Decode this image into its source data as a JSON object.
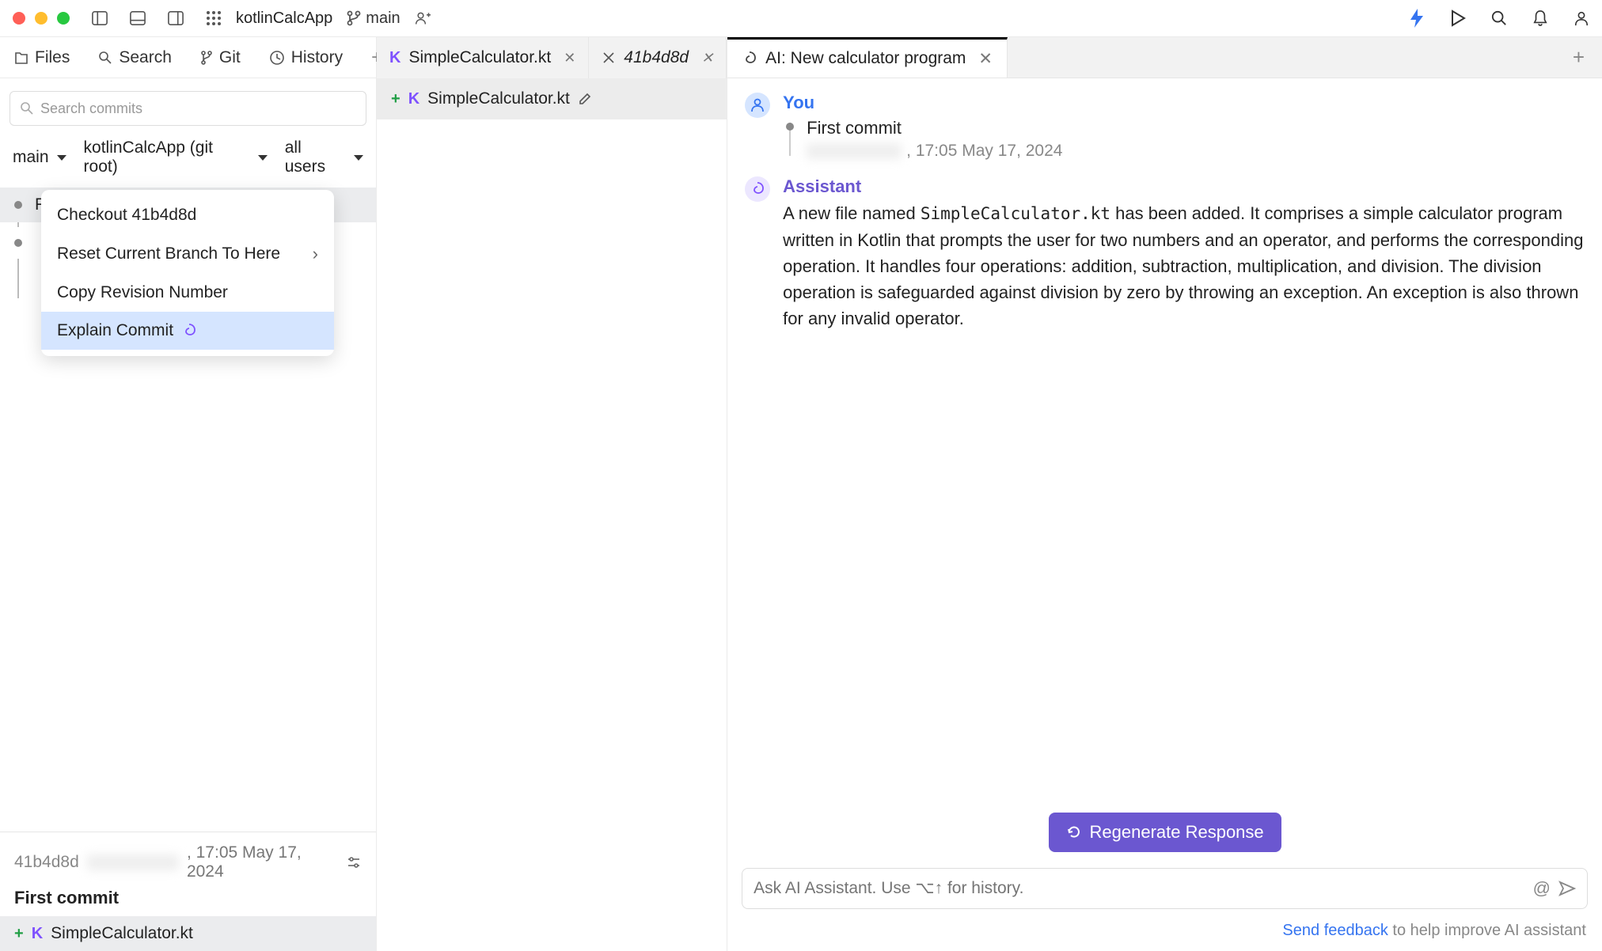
{
  "project": {
    "name": "kotlinCalcApp",
    "branch": "main"
  },
  "left_tabs": [
    "Files",
    "Search",
    "Git",
    "History"
  ],
  "left_active_tab": "History",
  "search_commits_placeholder": "Search commits",
  "filters": {
    "branch": "main",
    "repo": "kotlinCalcApp (git root)",
    "users": "all users"
  },
  "commits": [
    {
      "title": "First commit"
    }
  ],
  "context_menu": {
    "items": [
      {
        "label": "Checkout 41b4d8d",
        "submenu": false
      },
      {
        "label": "Reset Current Branch To Here",
        "submenu": true
      },
      {
        "label": "Copy Revision Number",
        "submenu": false
      },
      {
        "label": "Explain Commit",
        "submenu": false,
        "highlighted": true,
        "ai_icon": true
      }
    ]
  },
  "commit_detail": {
    "hash": "41b4d8d",
    "timestamp": ", 17:05 May 17, 2024",
    "title": "First commit",
    "files": [
      {
        "name": "SimpleCalculator.kt",
        "status": "added"
      }
    ]
  },
  "center_tabs": [
    {
      "label": "SimpleCalculator.kt",
      "kind": "kotlin",
      "closeable": true
    },
    {
      "label": "41b4d8d",
      "kind": "branch",
      "italic": true,
      "closeable": true
    }
  ],
  "opened_file_bar": {
    "name": "SimpleCalculator.kt",
    "status": "added"
  },
  "ai_tab": {
    "label": "AI: New calculator program"
  },
  "chat": {
    "you_label": "You",
    "you_title": "First commit",
    "you_meta": ", 17:05 May 17, 2024",
    "assistant_label": "Assistant",
    "assistant_text_prefix": "A new file named ",
    "assistant_code": "SimpleCalculator.kt",
    "assistant_text_suffix": " has been added. It comprises a simple calculator program written in Kotlin that prompts the user for two numbers and an operator, and performs the corresponding operation. It handles four operations: addition, subtraction, multiplication, and division. The division operation is safeguarded against division by zero by throwing an exception. An exception is also thrown for any invalid operator."
  },
  "regenerate_label": "Regenerate Response",
  "ai_input_placeholder": "Ask AI Assistant. Use ⌥↑ for history.",
  "feedback": {
    "link": "Send feedback",
    "rest": " to help improve AI assistant"
  }
}
